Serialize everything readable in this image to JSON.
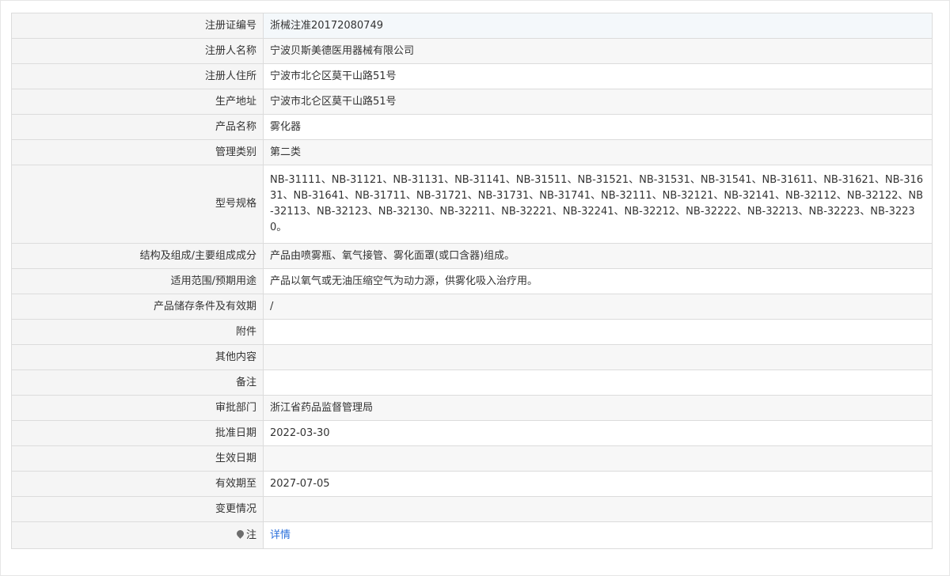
{
  "rows": [
    {
      "label": "注册证编号",
      "value": "浙械注准20172080749"
    },
    {
      "label": "注册人名称",
      "value": "宁波贝斯美德医用器械有限公司"
    },
    {
      "label": "注册人住所",
      "value": "宁波市北仑区莫干山路51号"
    },
    {
      "label": "生产地址",
      "value": "宁波市北仑区莫干山路51号"
    },
    {
      "label": "产品名称",
      "value": "雾化器"
    },
    {
      "label": "管理类别",
      "value": "第二类"
    },
    {
      "label": "型号规格",
      "value": "NB-31111、NB-31121、NB-31131、NB-31141、NB-31511、NB-31521、NB-31531、NB-31541、NB-31611、NB-31621、NB-31631、NB-31641、NB-31711、NB-31721、NB-31731、NB-31741、NB-32111、NB-32121、NB-32141、NB-32112、NB-32122、NB-32113、NB-32123、NB-32130、NB-32211、NB-32221、NB-32241、NB-32212、NB-32222、NB-32213、NB-32223、NB-32230。"
    },
    {
      "label": "结构及组成/主要组成成分",
      "value": "产品由喷雾瓶、氧气接管、雾化面罩(或口含器)组成。"
    },
    {
      "label": "适用范围/预期用途",
      "value": "产品以氧气或无油压缩空气为动力源，供雾化吸入治疗用。"
    },
    {
      "label": "产品储存条件及有效期",
      "value": "/"
    },
    {
      "label": "附件",
      "value": ""
    },
    {
      "label": "其他内容",
      "value": ""
    },
    {
      "label": "备注",
      "value": ""
    },
    {
      "label": "审批部门",
      "value": "浙江省药品监督管理局"
    },
    {
      "label": "批准日期",
      "value": "2022-03-30"
    },
    {
      "label": "生效日期",
      "value": ""
    },
    {
      "label": "有效期至",
      "value": "2027-07-05"
    },
    {
      "label": "变更情况",
      "value": ""
    }
  ],
  "note": {
    "icon": "location-pin-icon",
    "label": "注",
    "link_text": "详情"
  }
}
